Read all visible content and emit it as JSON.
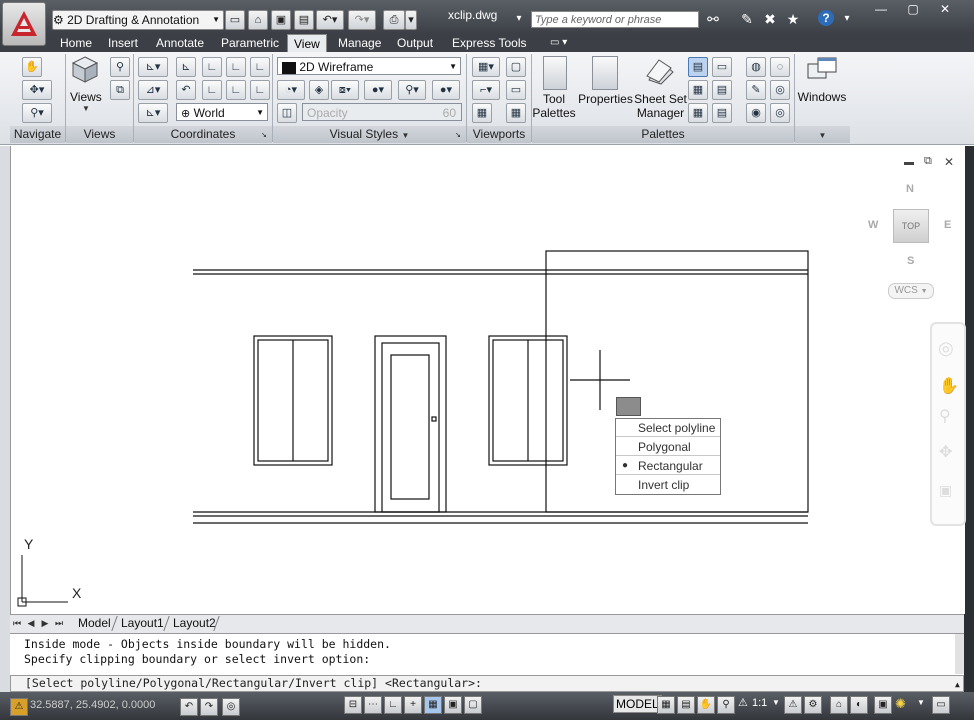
{
  "app": {
    "workspace": "2D Drafting & Annotation",
    "file_title": "xclip.dwg",
    "search_placeholder": "Type a keyword or phrase"
  },
  "tabs": [
    {
      "label": "Home"
    },
    {
      "label": "Insert"
    },
    {
      "label": "Annotate"
    },
    {
      "label": "Parametric"
    },
    {
      "label": "View",
      "active": true
    },
    {
      "label": "Manage"
    },
    {
      "label": "Output"
    },
    {
      "label": "Express Tools"
    }
  ],
  "ribbon": {
    "views_label": "Views",
    "visual_style": "2D Wireframe",
    "ucs_name": "World",
    "opacity_label": "Opacity",
    "opacity_value": "60",
    "tool_palettes": "Tool\nPalettes",
    "properties": "Properties",
    "sheet_set": "Sheet Set\nManager",
    "windows": "Windows",
    "panels": {
      "navigate": "Navigate",
      "views": "Views",
      "coordinates": "Coordinates",
      "visual_styles": "Visual Styles",
      "viewports": "Viewports",
      "palettes": "Palettes"
    }
  },
  "viewcube": {
    "north": "N",
    "south": "S",
    "east": "E",
    "west": "W",
    "face": "TOP",
    "wcs": "WCS"
  },
  "ucs_icon": {
    "y": "Y",
    "x": "X"
  },
  "context_menu": {
    "items": [
      {
        "label": "Select polyline",
        "checked": false
      },
      {
        "label": "Polygonal",
        "checked": false
      },
      {
        "label": "Rectangular",
        "checked": true
      },
      {
        "label": "Invert clip",
        "checked": false
      }
    ]
  },
  "layout_tabs": [
    {
      "label": "Model",
      "active": true
    },
    {
      "label": "Layout1"
    },
    {
      "label": "Layout2"
    }
  ],
  "command": {
    "history_1": "Inside mode - Objects inside boundary will be hidden.",
    "history_2": "Specify clipping boundary or select invert option:",
    "prompt": "[Select polyline/Polygonal/Rectangular/Invert clip] <Rectangular>:"
  },
  "status": {
    "coords": "32.5887, 25.4902, 0.0000",
    "model": "MODEL",
    "scale": "1:1"
  }
}
